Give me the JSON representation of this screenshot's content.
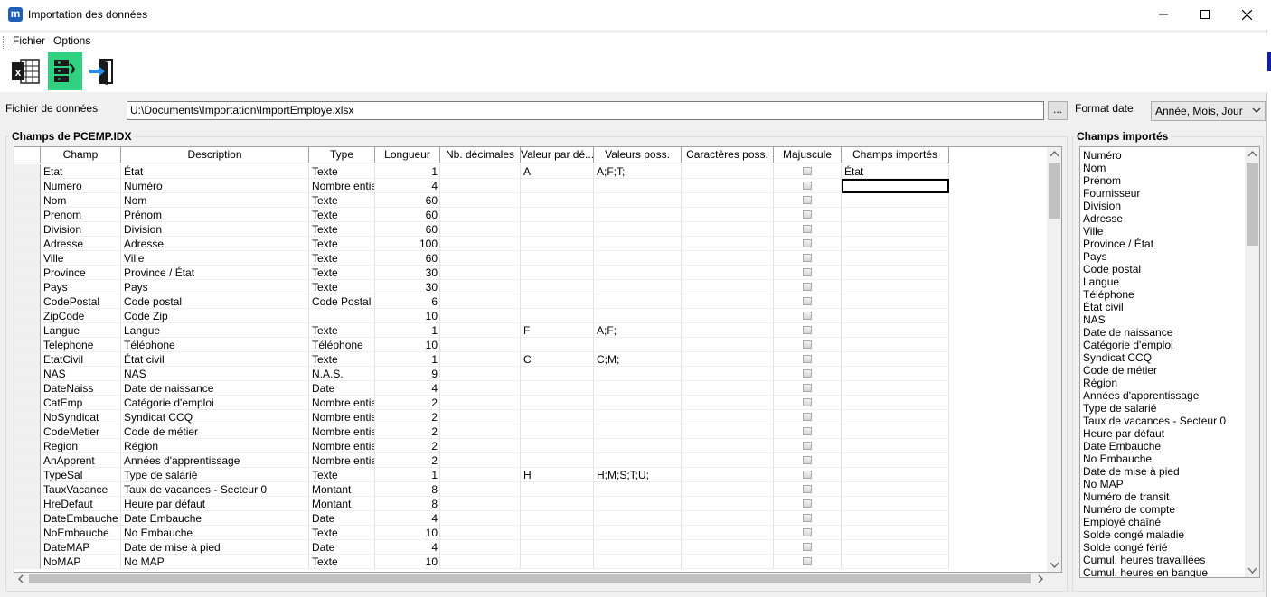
{
  "window": {
    "app_icon_letter": "m",
    "title": "Importation des données"
  },
  "menu": [
    "Fichier",
    "Options"
  ],
  "toolbar": {
    "buttons": [
      "excel-icon",
      "import-mapping-icon",
      "exit-icon"
    ]
  },
  "file": {
    "label": "Fichier de données",
    "value": "U:\\Documents\\Importation\\ImportEmploye.xlsx",
    "browse_label": "..."
  },
  "date_format": {
    "label": "Format date",
    "selected": "Année, Mois, Jour"
  },
  "left_group": {
    "title": "Champs de PCEMP.IDX",
    "columns": [
      "Champ",
      "Description",
      "Type",
      "Longueur",
      "Nb. décimales",
      "Valeur par dé...",
      "Valeurs poss.",
      "Caractères poss.",
      "Majuscule",
      "Champs importés"
    ],
    "rows": [
      [
        "Etat",
        "État",
        "Texte",
        "1",
        "",
        "A",
        "A;F;T;",
        "",
        "",
        "État"
      ],
      [
        "Numero",
        "Numéro",
        "Nombre entier",
        "4",
        "",
        "",
        "",
        "",
        "",
        ""
      ],
      [
        "Nom",
        "Nom",
        "Texte",
        "60",
        "",
        "",
        "",
        "",
        "",
        ""
      ],
      [
        "Prenom",
        "Prénom",
        "Texte",
        "60",
        "",
        "",
        "",
        "",
        "",
        ""
      ],
      [
        "Division",
        "Division",
        "Texte",
        "60",
        "",
        "",
        "",
        "",
        "",
        ""
      ],
      [
        "Adresse",
        "Adresse",
        "Texte",
        "100",
        "",
        "",
        "",
        "",
        "",
        ""
      ],
      [
        "Ville",
        "Ville",
        "Texte",
        "60",
        "",
        "",
        "",
        "",
        "",
        ""
      ],
      [
        "Province",
        "Province / État",
        "Texte",
        "30",
        "",
        "",
        "",
        "",
        "",
        ""
      ],
      [
        "Pays",
        "Pays",
        "Texte",
        "30",
        "",
        "",
        "",
        "",
        "",
        ""
      ],
      [
        "CodePostal",
        "Code postal",
        "Code Postal",
        "6",
        "",
        "",
        "",
        "",
        "",
        ""
      ],
      [
        "ZipCode",
        "Code Zip",
        "",
        "10",
        "",
        "",
        "",
        "",
        "",
        ""
      ],
      [
        "Langue",
        "Langue",
        "Texte",
        "1",
        "",
        "F",
        "A;F;",
        "",
        "",
        ""
      ],
      [
        "Telephone",
        "Téléphone",
        "Téléphone",
        "10",
        "",
        "",
        "",
        "",
        "",
        ""
      ],
      [
        "EtatCivil",
        "État civil",
        "Texte",
        "1",
        "",
        "C",
        "C;M;",
        "",
        "",
        ""
      ],
      [
        "NAS",
        "NAS",
        "N.A.S.",
        "9",
        "",
        "",
        "",
        "",
        "",
        ""
      ],
      [
        "DateNaiss",
        "Date de naissance",
        "Date",
        "4",
        "",
        "",
        "",
        "",
        "",
        ""
      ],
      [
        "CatEmp",
        "Catégorie d'emploi",
        "Nombre entier",
        "2",
        "",
        "",
        "",
        "",
        "",
        ""
      ],
      [
        "NoSyndicat",
        "Syndicat CCQ",
        "Nombre entier",
        "2",
        "",
        "",
        "",
        "",
        "",
        ""
      ],
      [
        "CodeMetier",
        "Code de métier",
        "Nombre entier",
        "2",
        "",
        "",
        "",
        "",
        "",
        ""
      ],
      [
        "Region",
        "Région",
        "Nombre entier",
        "2",
        "",
        "",
        "",
        "",
        "",
        ""
      ],
      [
        "AnApprent",
        "Années d'apprentissage",
        "Nombre entier",
        "2",
        "",
        "",
        "",
        "",
        "",
        ""
      ],
      [
        "TypeSal",
        "Type de salarié",
        "Texte",
        "1",
        "",
        "H",
        "H;M;S;T;U;",
        "",
        "",
        ""
      ],
      [
        "TauxVacance",
        "Taux de vacances - Secteur 0",
        "Montant",
        "8",
        "",
        "",
        "",
        "",
        "",
        ""
      ],
      [
        "HreDefaut",
        "Heure par défaut",
        "Montant",
        "8",
        "",
        "",
        "",
        "",
        "",
        ""
      ],
      [
        "DateEmbauche",
        "Date Embauche",
        "Date",
        "4",
        "",
        "",
        "",
        "",
        "",
        ""
      ],
      [
        "NoEmbauche",
        "No Embauche",
        "Texte",
        "10",
        "",
        "",
        "",
        "",
        "",
        ""
      ],
      [
        "DateMAP",
        "Date de mise à pied",
        "Date",
        "4",
        "",
        "",
        "",
        "",
        "",
        ""
      ],
      [
        "NoMAP",
        "No MAP",
        "Texte",
        "10",
        "",
        "",
        "",
        "",
        "",
        ""
      ]
    ]
  },
  "right_group": {
    "title": "Champs importés",
    "items": [
      "Numéro",
      "Nom",
      "Prénom",
      "Fournisseur",
      "Division",
      "Adresse",
      "Ville",
      "Province / État",
      "Pays",
      "Code postal",
      "Langue",
      "Téléphone",
      "État civil",
      "NAS",
      "Date de naissance",
      "Catégorie d'emploi",
      "Syndicat CCQ",
      "Code de métier",
      "Région",
      "Années d'apprentissage",
      "Type de salarié",
      "Taux de vacances - Secteur 0",
      "Heure par défaut",
      "Date Embauche",
      "No Embauche",
      "Date de mise à pied",
      "No MAP",
      "Numéro de transit",
      "Numéro de compte",
      "Employé chaîné",
      "Solde congé maladie",
      "Solde congé férié",
      "Cumul. heures travaillées",
      "Cumul. heures en banque"
    ]
  },
  "colors": {
    "active_tool": "#30d180",
    "app_icon": "#1e5fb8"
  }
}
